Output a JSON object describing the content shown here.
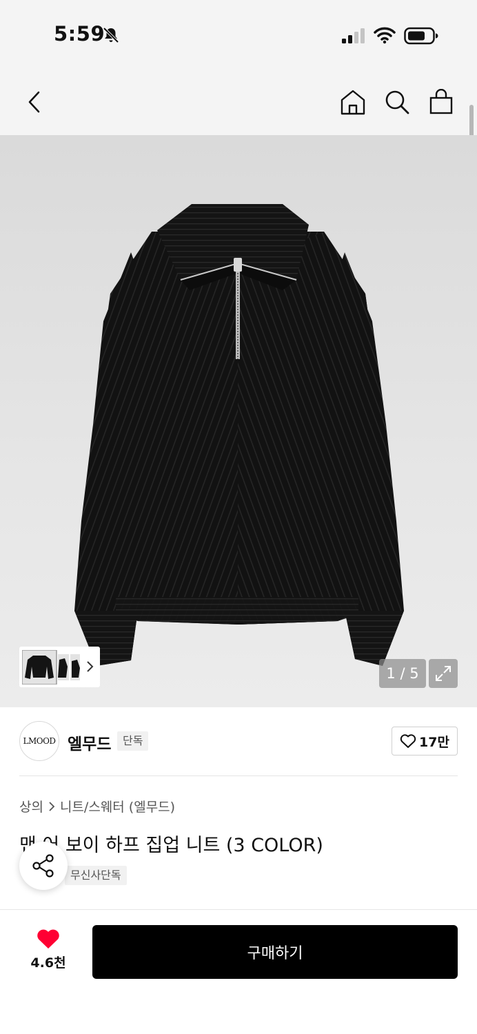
{
  "status_bar": {
    "time": "5:59",
    "icons": [
      "bell-slash-icon",
      "signal-icon",
      "wifi-icon",
      "battery-icon"
    ]
  },
  "nav": {
    "icons": [
      "chevron-left-icon",
      "home-icon",
      "search-icon",
      "shopping-bag-icon"
    ]
  },
  "gallery": {
    "counter": "1 / 5",
    "background_color": "#dcdcdc",
    "product_color": "#111111"
  },
  "brand": {
    "logo_text": "LMOOD",
    "name": "엘무드",
    "badge": "단독",
    "like_count": "17만"
  },
  "product": {
    "breadcrumb": [
      "상의",
      "니트/스웨터 (엘무드)"
    ],
    "title": "맨 어 보이 하프 집업 니트 (3 COLOR)",
    "exclusive_badge": "무신사단독"
  },
  "bottom_bar": {
    "wish_count": "4.6천",
    "buy_label": "구매하기",
    "heart_color": "#ff0033"
  }
}
